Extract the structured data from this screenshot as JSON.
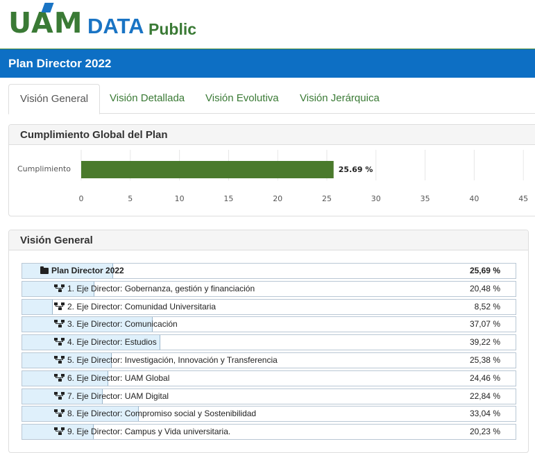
{
  "brand": {
    "logo": "UAM",
    "data": "DATA",
    "public": "Public"
  },
  "header": {
    "title": "Plan Director 2022"
  },
  "tabs": [
    {
      "label": "Visión General",
      "active": true
    },
    {
      "label": "Visión Detallada",
      "active": false
    },
    {
      "label": "Visión Evolutiva",
      "active": false
    },
    {
      "label": "Visión Jerárquica",
      "active": false
    }
  ],
  "global_panel": {
    "title": "Cumplimiento Global del Plan"
  },
  "chart_data": {
    "type": "bar",
    "orientation": "horizontal",
    "categories": [
      "Cumplimiento"
    ],
    "values": [
      25.69
    ],
    "value_labels": [
      "25.69 %"
    ],
    "xlim": [
      0,
      45
    ],
    "xticks": [
      0,
      5,
      10,
      15,
      20,
      25,
      30,
      35,
      40,
      45
    ],
    "grid": true,
    "bar_color": "#4a7a2c"
  },
  "overview_panel": {
    "title": "Visión General"
  },
  "tree": [
    {
      "label": "Plan Director 2022",
      "value": "25,69 %",
      "icon": "folder-icon",
      "root": true,
      "progress": 0.2569
    },
    {
      "label": "1. Eje Director: Gobernanza, gestión y financiación",
      "value": "20,48 %",
      "icon": "sitemap-icon",
      "progress": 0.2048
    },
    {
      "label": "2. Eje Director: Comunidad Universitaria",
      "value": "8,52 %",
      "icon": "sitemap-icon",
      "progress": 0.0852
    },
    {
      "label": "3. Eje Director: Comunicación",
      "value": "37,07 %",
      "icon": "sitemap-icon",
      "progress": 0.3707
    },
    {
      "label": "4. Eje Director: Estudios",
      "value": "39,22 %",
      "icon": "sitemap-icon",
      "progress": 0.3922
    },
    {
      "label": "5. Eje Director: Investigación, Innovación y Transferencia",
      "value": "25,38 %",
      "icon": "sitemap-icon",
      "progress": 0.2538
    },
    {
      "label": "6. Eje Director: UAM Global",
      "value": "24,46 %",
      "icon": "sitemap-icon",
      "progress": 0.2446
    },
    {
      "label": "7. Eje Director: UAM Digital",
      "value": "22,84 %",
      "icon": "sitemap-icon",
      "progress": 0.2284
    },
    {
      "label": "8. Eje Director: Compromiso social y Sostenibilidad",
      "value": "33,04 %",
      "icon": "sitemap-icon",
      "progress": 0.3304
    },
    {
      "label": "9. Eje Director: Campus y Vida universitaria.",
      "value": "20,23 %",
      "icon": "sitemap-icon",
      "progress": 0.2023
    }
  ]
}
